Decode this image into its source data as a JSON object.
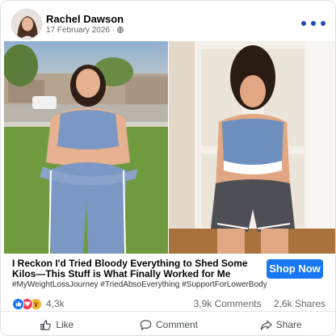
{
  "post": {
    "author": "Rachel Dawson",
    "date": "17 February 2026",
    "privacy_icon": "globe-icon",
    "more_icon": "more-dots-icon"
  },
  "ad": {
    "headline": "I Reckon I'd Tried Bloody Everything to Shed Some Kilos—This Stuff is What Finally Worked for Me",
    "hashtags": "#MyWeightLossJourney #TriedAbsoEverything #SupportForLowerBody",
    "cta_label": "Shop Now",
    "cta_color": "#1877f2"
  },
  "stats": {
    "reactions_count": "4,3k",
    "reaction_icons": [
      "like-icon",
      "love-icon",
      "wow-icon"
    ],
    "comments": "3,9k Comments",
    "shares": "2,6k Shares"
  },
  "actions": {
    "like_label": "Like",
    "comment_label": "Comment",
    "share_label": "Share"
  }
}
